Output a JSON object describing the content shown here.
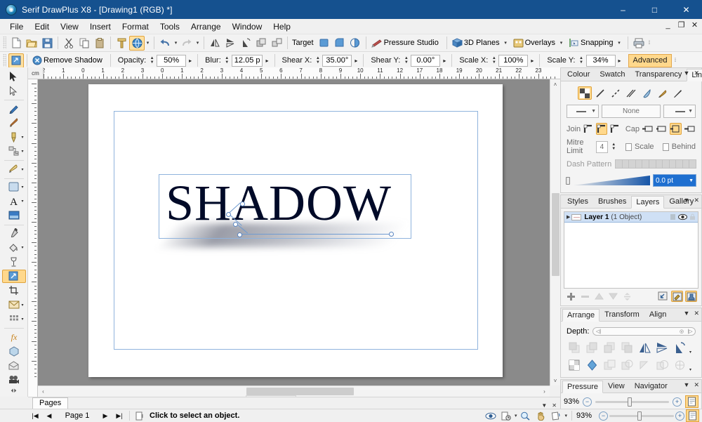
{
  "window": {
    "title": "Serif DrawPlus X8 - [Drawing1 (RGB) *]",
    "app_icon": "drawplus-icon",
    "minimize": "–",
    "maximize": "□",
    "close": "✕",
    "mdi_minimize": "_",
    "mdi_restore": "❐",
    "mdi_close": "✕"
  },
  "menubar": {
    "items": [
      {
        "label": "File"
      },
      {
        "label": "Edit"
      },
      {
        "label": "View"
      },
      {
        "label": "Insert"
      },
      {
        "label": "Format"
      },
      {
        "label": "Tools"
      },
      {
        "label": "Arrange"
      },
      {
        "label": "Window"
      },
      {
        "label": "Help"
      }
    ]
  },
  "standard_toolbar": {
    "buttons": [
      {
        "name": "new-document",
        "icon": "page-icon"
      },
      {
        "name": "open-document",
        "icon": "folder-icon"
      },
      {
        "name": "save-document",
        "icon": "floppy-icon"
      },
      {
        "name": "cut",
        "icon": "scissors-icon"
      },
      {
        "name": "copy",
        "icon": "copy-icon"
      },
      {
        "name": "paste",
        "icon": "clipboard-icon"
      },
      {
        "name": "format-painter",
        "icon": "format-painter-icon"
      },
      {
        "name": "studio-toggle",
        "icon": "globe-icon"
      },
      {
        "name": "undo",
        "icon": "undo-arrow-icon"
      },
      {
        "name": "redo",
        "icon": "redo-arrow-icon"
      },
      {
        "name": "flip-horizontal",
        "icon": "flip-horizontal-icon"
      },
      {
        "name": "flip-vertical",
        "icon": "flip-vertical-icon"
      },
      {
        "name": "rotate",
        "icon": "rotate-icon"
      },
      {
        "name": "group",
        "icon": "group-icon"
      },
      {
        "name": "ungroup",
        "icon": "ungroup-icon"
      }
    ],
    "target_label": "Target",
    "target_buttons": [
      {
        "name": "target-shape-1",
        "icon": "square-blue-icon"
      },
      {
        "name": "target-shape-2",
        "icon": "rounded-blue-icon"
      },
      {
        "name": "target-shape-3",
        "icon": "pie-blue-icon"
      }
    ],
    "pressure_studio": "Pressure Studio",
    "planes_3d": "3D Planes",
    "overlays": "Overlays",
    "snapping": "Snapping",
    "print_icon": "printer-icon",
    "overflow": "⁞"
  },
  "shadow_toolbar": {
    "tool_icon": "shadow-tool-icon",
    "remove_shadow": "Remove Shadow",
    "remove_icon": "remove-circle-icon",
    "fields": [
      {
        "label": "Opacity:",
        "value": "50%"
      },
      {
        "label": "Blur:",
        "value": "12.05 p"
      },
      {
        "label": "Shear X:",
        "value": "35.00°"
      },
      {
        "label": "Shear Y:",
        "value": "0.00°"
      },
      {
        "label": "Scale X:",
        "value": "100%"
      },
      {
        "label": "Scale Y:",
        "value": "34%"
      }
    ],
    "advanced": "Advanced",
    "overflow": "⁞"
  },
  "tools": [
    {
      "name": "pointer-tool",
      "icon": "arrow-pointer-icon",
      "selected": false,
      "dropdown": false
    },
    {
      "name": "node-edit-tool",
      "icon": "node-arrow-icon",
      "selected": false,
      "dropdown": false
    },
    {
      "name": "pencil-tool",
      "icon": "pencil-icon",
      "selected": false,
      "dropdown": false
    },
    {
      "name": "paintbrush-tool",
      "icon": "paintbrush-icon",
      "selected": false,
      "dropdown": false
    },
    {
      "name": "pen-tool",
      "icon": "fountain-pen-icon",
      "selected": false,
      "dropdown": true
    },
    {
      "name": "connector-tool",
      "icon": "connector-icon",
      "selected": false,
      "dropdown": true
    },
    {
      "name": "brush-tool",
      "icon": "brush-stroke-icon",
      "selected": false,
      "dropdown": true
    },
    {
      "name": "shape-tool",
      "icon": "rectangle-icon",
      "selected": false,
      "dropdown": true
    },
    {
      "name": "text-tool",
      "icon": "letter-a-icon",
      "selected": false,
      "dropdown": true
    },
    {
      "name": "picture-tool",
      "icon": "picture-frame-icon",
      "selected": false,
      "dropdown": false
    },
    {
      "name": "colour-picker-tool",
      "icon": "eyedropper-icon",
      "selected": false,
      "dropdown": false
    },
    {
      "name": "fill-tool",
      "icon": "paint-bucket-icon",
      "selected": false,
      "dropdown": true
    },
    {
      "name": "transparency-tool",
      "icon": "goblet-icon",
      "selected": false,
      "dropdown": false
    },
    {
      "name": "shadow-tool",
      "icon": "shadow-box-icon",
      "selected": true,
      "dropdown": false
    },
    {
      "name": "crop-tool",
      "icon": "crop-icon",
      "selected": false,
      "dropdown": false
    },
    {
      "name": "envelope-tool",
      "icon": "envelope-icon",
      "selected": false,
      "dropdown": true
    },
    {
      "name": "perspective-tool",
      "icon": "mesh-grid-icon",
      "selected": false,
      "dropdown": true
    },
    {
      "name": "effects-tool",
      "icon": "fx-icon",
      "selected": false,
      "dropdown": false
    },
    {
      "name": "extrude-tool",
      "icon": "extrude-icon",
      "selected": false,
      "dropdown": false
    },
    {
      "name": "mesh-warp-tool",
      "icon": "mesh-warp-icon",
      "selected": false,
      "dropdown": false
    },
    {
      "name": "stopframe-tool",
      "icon": "movie-camera-icon",
      "selected": false,
      "dropdown": false
    }
  ],
  "rulers": {
    "unit": "cm",
    "horizontal_labels": [
      "2",
      "1",
      "0",
      "1",
      "2",
      "3",
      "0",
      "1",
      "2",
      "3",
      "4",
      "5",
      "6",
      "7",
      "8",
      "9",
      "10",
      "11",
      "12",
      "17",
      "18",
      "19",
      "20",
      "21",
      "22",
      "23"
    ],
    "vertical_labels": [
      "2",
      "1",
      "0",
      "1",
      "2",
      "3",
      "4",
      "5",
      "6",
      "7",
      "8",
      "9",
      "10",
      "11",
      "12"
    ]
  },
  "canvas": {
    "artwork_text": "SHADOW",
    "artwork_colour": "#000a28",
    "page_background": "#ffffff",
    "margin_colour": "#8fb3dd",
    "selection_colour": "#8fb3dd"
  },
  "line_panel": {
    "tabs": [
      {
        "label": "Colour",
        "selected": false
      },
      {
        "label": "Swatch",
        "selected": false
      },
      {
        "label": "Transparency",
        "selected": false
      },
      {
        "label": "Line",
        "selected": true
      }
    ],
    "menu_icon": "▼",
    "close_icon": "✕",
    "stroke_types": [
      {
        "name": "no-stroke",
        "icon": "checker-icon",
        "selected": true
      },
      {
        "name": "solid-stroke",
        "icon": "solid-line-icon",
        "selected": false
      },
      {
        "name": "dashed-stroke",
        "icon": "dashed-line-icon",
        "selected": false
      },
      {
        "name": "double-stroke",
        "icon": "double-line-icon",
        "selected": false
      },
      {
        "name": "calligraphic-stroke",
        "icon": "quill-icon",
        "selected": false
      },
      {
        "name": "brush-stroke",
        "icon": "brush-icon",
        "selected": false
      },
      {
        "name": "pressure-stroke",
        "icon": "pressure-line-icon",
        "selected": false
      }
    ],
    "start_cap_value": "",
    "line_style_value": "None",
    "end_cap_value": "",
    "join_label": "Join",
    "join_buttons": [
      {
        "name": "join-round",
        "selected": false
      },
      {
        "name": "join-bevel",
        "selected": true
      },
      {
        "name": "join-mitre",
        "selected": false
      }
    ],
    "cap_label": "Cap",
    "cap_buttons": [
      {
        "name": "cap-round",
        "selected": false
      },
      {
        "name": "cap-square",
        "selected": false
      },
      {
        "name": "cap-butt",
        "selected": true
      },
      {
        "name": "cap-flat",
        "selected": false
      }
    ],
    "mitre_limit_label": "Mitre Limit",
    "mitre_limit_value": "4",
    "scale_label": "Scale",
    "scale_checked": false,
    "behind_label": "Behind",
    "behind_checked": false,
    "dash_pattern_label": "Dash Pattern",
    "dash_cells": 12,
    "width_value": "0.0 pt"
  },
  "layers_panel": {
    "tabs": [
      {
        "label": "Styles",
        "selected": false
      },
      {
        "label": "Brushes",
        "selected": false
      },
      {
        "label": "Layers",
        "selected": true
      },
      {
        "label": "Gallery",
        "selected": false
      }
    ],
    "menu_icon": "▼",
    "close_icon": "✕",
    "layers": [
      {
        "name": "Layer 1",
        "object_count": "(1 Object)",
        "expanded": false,
        "visible": true,
        "locked": false
      }
    ],
    "toolbar": [
      {
        "name": "add-layer-button",
        "icon": "plus-icon",
        "enabled": true
      },
      {
        "name": "delete-layer-button",
        "icon": "minus-icon",
        "enabled": false
      },
      {
        "name": "move-layer-up-button",
        "icon": "triangle-up-icon",
        "enabled": false
      },
      {
        "name": "move-layer-down-button",
        "icon": "triangle-down-icon",
        "enabled": false
      },
      {
        "name": "merge-layer-button",
        "icon": "merge-icon",
        "enabled": false
      },
      {
        "name": "select-all-on-layer-button",
        "icon": "select-layer-icon",
        "enabled": true
      },
      {
        "name": "layer-properties-button",
        "icon": "layer-paint-icon",
        "enabled": true
      },
      {
        "name": "layer-effects-button",
        "icon": "layer-stamp-icon",
        "enabled": true
      }
    ]
  },
  "arrange_panel": {
    "tabs": [
      {
        "label": "Arrange",
        "selected": true
      },
      {
        "label": "Transform",
        "selected": false
      },
      {
        "label": "Align",
        "selected": false
      }
    ],
    "menu_icon": "▼",
    "close_icon": "✕",
    "depth_label": "Depth:",
    "row1": [
      {
        "name": "bring-to-front-button",
        "icon": "bring-front-icon",
        "enabled": false
      },
      {
        "name": "bring-forward-button",
        "icon": "forward-one-icon",
        "enabled": false
      },
      {
        "name": "send-backward-button",
        "icon": "back-one-icon",
        "enabled": false
      },
      {
        "name": "send-to-back-button",
        "icon": "send-back-icon",
        "enabled": false
      },
      {
        "name": "flip-horizontal-button",
        "icon": "flip-horizontal-icon",
        "enabled": true
      },
      {
        "name": "flip-vertical-button",
        "icon": "flip-vertical-icon",
        "enabled": true
      },
      {
        "name": "rotate-button",
        "icon": "rotate-icon",
        "enabled": true
      }
    ],
    "row2": [
      {
        "name": "crop-to-shape-button",
        "icon": "checker-square-icon",
        "enabled": true
      },
      {
        "name": "combine-button",
        "icon": "blue-hexagon-icon",
        "enabled": true
      },
      {
        "name": "add-shapes-button",
        "icon": "add-shapes-icon",
        "enabled": false
      },
      {
        "name": "subtract-shapes-button",
        "icon": "subtract-shapes-icon",
        "enabled": false
      },
      {
        "name": "intersect-shapes-button",
        "icon": "intersect-shapes-icon",
        "enabled": false
      },
      {
        "name": "exclude-shapes-button",
        "icon": "exclude-shapes-icon",
        "enabled": false
      },
      {
        "name": "join-shapes-button",
        "icon": "join-shapes-icon",
        "enabled": false
      }
    ]
  },
  "pressure_panel": {
    "tabs": [
      {
        "label": "Pressure",
        "selected": true
      },
      {
        "label": "View",
        "selected": false
      },
      {
        "label": "Navigator",
        "selected": false
      }
    ],
    "menu_icon": "▼",
    "close_icon": "✕",
    "zoom_value": "93%",
    "zoom_out_icon": "minus-circle-icon",
    "zoom_in_icon": "plus-circle-icon",
    "fit_page_icon": "fit-page-icon"
  },
  "pages_tabstrip": {
    "tab_label": "Pages",
    "menu_icon": "▼",
    "close_icon": "✕"
  },
  "statusbar": {
    "first_page_icon": "|◀",
    "prev_page_icon": "◀",
    "page_label": "Page 1",
    "next_page_icon": "▶",
    "last_page_icon": "▶|",
    "page_setup_icon": "page-setup-icon",
    "hint": "Click to select an object.",
    "right_icons": [
      {
        "name": "view-quality-icon",
        "glyph": "eye"
      },
      {
        "name": "page-view-icon",
        "glyph": "page-clock"
      },
      {
        "name": "zoom-tool-icon",
        "glyph": "magnifier"
      },
      {
        "name": "pan-tool-icon",
        "glyph": "hand"
      },
      {
        "name": "rotate-view-icon",
        "glyph": "rotate-page"
      }
    ],
    "zoom_value": "93%"
  }
}
